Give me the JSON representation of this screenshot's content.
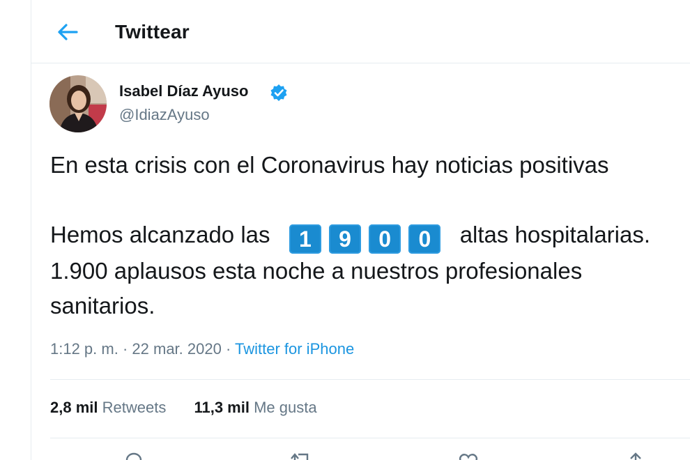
{
  "header": {
    "title": "Twittear",
    "back_icon": "arrow-left-icon",
    "accent": "#1da1f2"
  },
  "author": {
    "name": "Isabel Díaz Ayuso",
    "handle": "@IdiazAyuso",
    "verified": true,
    "verified_color": "#1da1f2"
  },
  "tweet": {
    "line1": "En esta crisis con el Coronavirus hay noticias positivas",
    "line2_prefix": "Hemos alcanzado las",
    "digits": [
      "1",
      "9",
      "0",
      "0"
    ],
    "line2_suffix": "altas hospitalarias.",
    "line3": "1.900 aplausos esta noche a nuestros profesionales",
    "line4": "sanitarios."
  },
  "meta": {
    "time": "1:12 p. m.",
    "separator": " · ",
    "date": "22 mar. 2020",
    "source": "Twitter for iPhone"
  },
  "stats": {
    "retweets_count": "2,8 mil",
    "retweets_label": "Retweets",
    "likes_count": "11,3 mil",
    "likes_label": "Me gusta"
  },
  "actions": [
    "reply-icon",
    "retweet-icon",
    "like-icon",
    "share-icon"
  ],
  "colors": {
    "link": "#1b95e0",
    "secondary_text": "#657786",
    "keycap": "#1a8bd0"
  }
}
